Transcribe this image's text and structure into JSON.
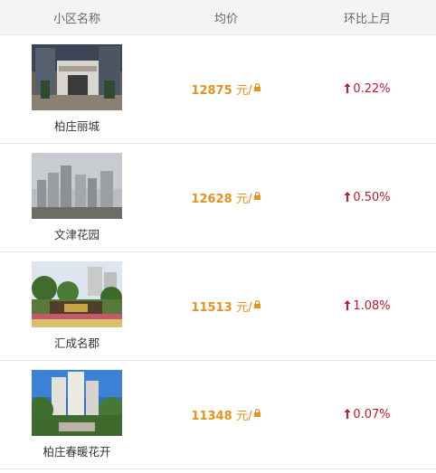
{
  "header": {
    "name": "小区名称",
    "price": "均价",
    "change": "环比上月"
  },
  "rows": [
    {
      "name": "柏庄丽城",
      "price": "12875",
      "unit": "元/",
      "change": "0.22%",
      "trend": "up"
    },
    {
      "name": "文津花园",
      "price": "12628",
      "unit": "元/",
      "change": "0.50%",
      "trend": "up"
    },
    {
      "name": "汇成名郡",
      "price": "11513",
      "unit": "元/",
      "change": "1.08%",
      "trend": "up"
    },
    {
      "name": "柏庄春暖花开",
      "price": "11348",
      "unit": "元/",
      "change": "0.07%",
      "trend": "up"
    }
  ],
  "colors": {
    "price": "#e8921d",
    "up": "#c0192b"
  },
  "icons": {
    "price_suffix": "lock-icon",
    "trend": "arrow-up-icon"
  }
}
